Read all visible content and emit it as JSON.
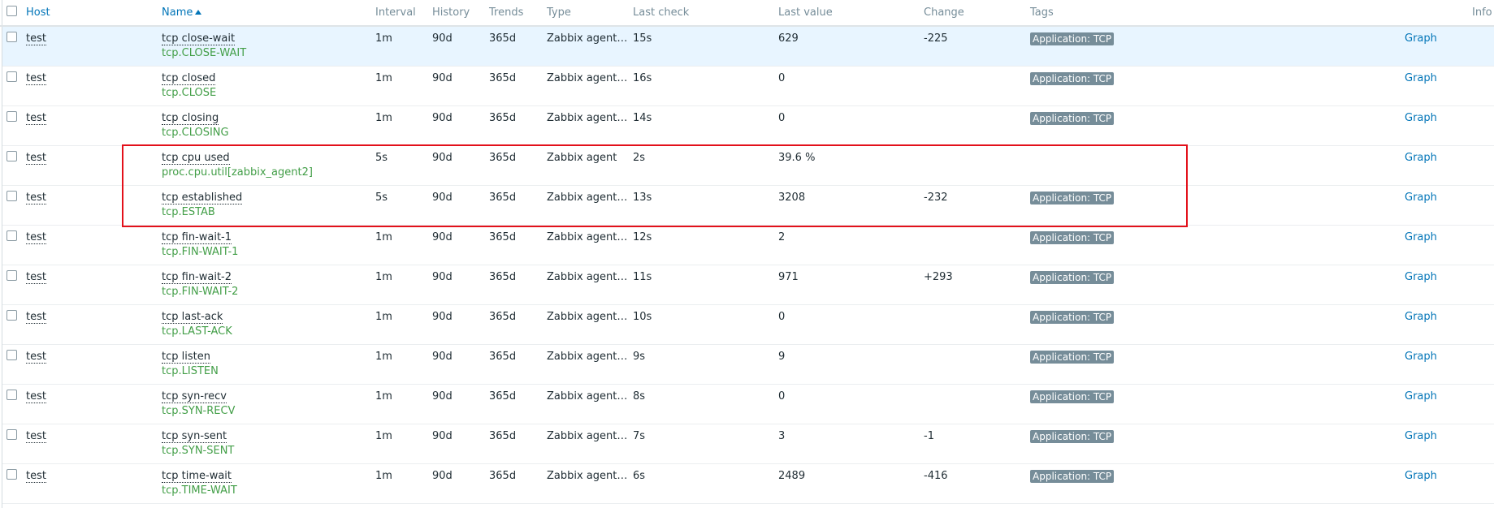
{
  "header": {
    "host": "Host",
    "name": "Name",
    "interval": "Interval",
    "history": "History",
    "trends": "Trends",
    "type": "Type",
    "last_check": "Last check",
    "last_value": "Last value",
    "change": "Change",
    "tags": "Tags",
    "info": "Info"
  },
  "sort": {
    "column": "Name",
    "direction": "ascending",
    "icon": "sort-up-arrow-icon"
  },
  "colors": {
    "link": "#0275b8",
    "key_green": "#429e47",
    "tag_bg": "#768d99",
    "highlight_row": "#e8f5ff",
    "highlight_box": "#e3101a"
  },
  "rows": [
    {
      "host": "test",
      "name": "tcp close-wait",
      "key": "tcp.CLOSE-WAIT",
      "interval": "1m",
      "history": "90d",
      "trends": "365d",
      "type": "Zabbix agent (a…",
      "last_check": "15s",
      "last_value": "629",
      "change": "-225",
      "tag": "Application: TCP",
      "action": "Graph"
    },
    {
      "host": "test",
      "name": "tcp closed",
      "key": "tcp.CLOSE",
      "interval": "1m",
      "history": "90d",
      "trends": "365d",
      "type": "Zabbix agent (a…",
      "last_check": "16s",
      "last_value": "0",
      "change": "",
      "tag": "Application: TCP",
      "action": "Graph"
    },
    {
      "host": "test",
      "name": "tcp closing",
      "key": "tcp.CLOSING",
      "interval": "1m",
      "history": "90d",
      "trends": "365d",
      "type": "Zabbix agent (a…",
      "last_check": "14s",
      "last_value": "0",
      "change": "",
      "tag": "Application: TCP",
      "action": "Graph"
    },
    {
      "host": "test",
      "name": "tcp cpu used",
      "key": "proc.cpu.util[zabbix_agent2]",
      "interval": "5s",
      "history": "90d",
      "trends": "365d",
      "type": "Zabbix agent",
      "last_check": "2s",
      "last_value": "39.6 %",
      "change": "",
      "tag": "",
      "action": "Graph"
    },
    {
      "host": "test",
      "name": "tcp established",
      "key": "tcp.ESTAB",
      "interval": "5s",
      "history": "90d",
      "trends": "365d",
      "type": "Zabbix agent (a…",
      "last_check": "13s",
      "last_value": "3208",
      "change": "-232",
      "tag": "Application: TCP",
      "action": "Graph"
    },
    {
      "host": "test",
      "name": "tcp fin-wait-1",
      "key": "tcp.FIN-WAIT-1",
      "interval": "1m",
      "history": "90d",
      "trends": "365d",
      "type": "Zabbix agent (a…",
      "last_check": "12s",
      "last_value": "2",
      "change": "",
      "tag": "Application: TCP",
      "action": "Graph"
    },
    {
      "host": "test",
      "name": "tcp fin-wait-2",
      "key": "tcp.FIN-WAIT-2",
      "interval": "1m",
      "history": "90d",
      "trends": "365d",
      "type": "Zabbix agent (a…",
      "last_check": "11s",
      "last_value": "971",
      "change": "+293",
      "tag": "Application: TCP",
      "action": "Graph"
    },
    {
      "host": "test",
      "name": "tcp last-ack",
      "key": "tcp.LAST-ACK",
      "interval": "1m",
      "history": "90d",
      "trends": "365d",
      "type": "Zabbix agent (a…",
      "last_check": "10s",
      "last_value": "0",
      "change": "",
      "tag": "Application: TCP",
      "action": "Graph"
    },
    {
      "host": "test",
      "name": "tcp listen",
      "key": "tcp.LISTEN",
      "interval": "1m",
      "history": "90d",
      "trends": "365d",
      "type": "Zabbix agent (a…",
      "last_check": "9s",
      "last_value": "9",
      "change": "",
      "tag": "Application: TCP",
      "action": "Graph"
    },
    {
      "host": "test",
      "name": "tcp syn-recv",
      "key": "tcp.SYN-RECV",
      "interval": "1m",
      "history": "90d",
      "trends": "365d",
      "type": "Zabbix agent (a…",
      "last_check": "8s",
      "last_value": "0",
      "change": "",
      "tag": "Application: TCP",
      "action": "Graph"
    },
    {
      "host": "test",
      "name": "tcp syn-sent",
      "key": "tcp.SYN-SENT",
      "interval": "1m",
      "history": "90d",
      "trends": "365d",
      "type": "Zabbix agent (a…",
      "last_check": "7s",
      "last_value": "3",
      "change": "-1",
      "tag": "Application: TCP",
      "action": "Graph"
    },
    {
      "host": "test",
      "name": "tcp time-wait",
      "key": "tcp.TIME-WAIT",
      "interval": "1m",
      "history": "90d",
      "trends": "365d",
      "type": "Zabbix agent (a…",
      "last_check": "6s",
      "last_value": "2489",
      "change": "-416",
      "tag": "Application: TCP",
      "action": "Graph"
    }
  ]
}
